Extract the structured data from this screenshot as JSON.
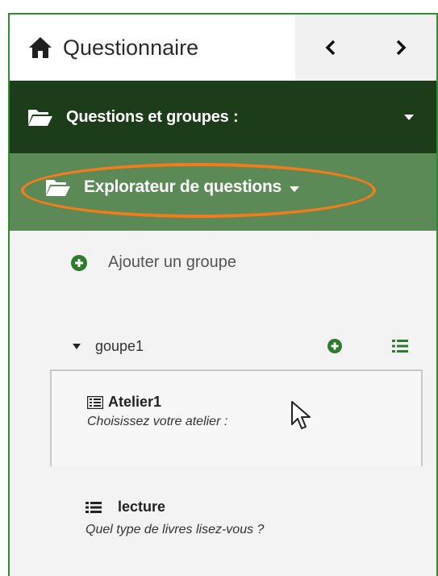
{
  "header": {
    "title": "Questionnaire",
    "prev_icon": "chevron-left-icon",
    "next_icon": "chevron-right-icon"
  },
  "section": {
    "label": "Questions et groupes :",
    "icon": "folder-open-icon"
  },
  "explorer": {
    "label": "Explorateur de questions",
    "icon": "folder-open-icon"
  },
  "add_group": {
    "label": "Ajouter un groupe",
    "icon": "plus-circle-icon"
  },
  "group": {
    "name": "goupe1",
    "questions": [
      {
        "code": "Atelier1",
        "text": "Choisissez votre atelier :"
      },
      {
        "code": "lecture",
        "text": "Quel type de livres lisez-vous ?"
      }
    ]
  },
  "colors": {
    "dark_green": "#1d3d1a",
    "mid_green": "#5b8a57",
    "accent_green": "#2e7a2e",
    "highlight_orange": "#f07c1b"
  }
}
